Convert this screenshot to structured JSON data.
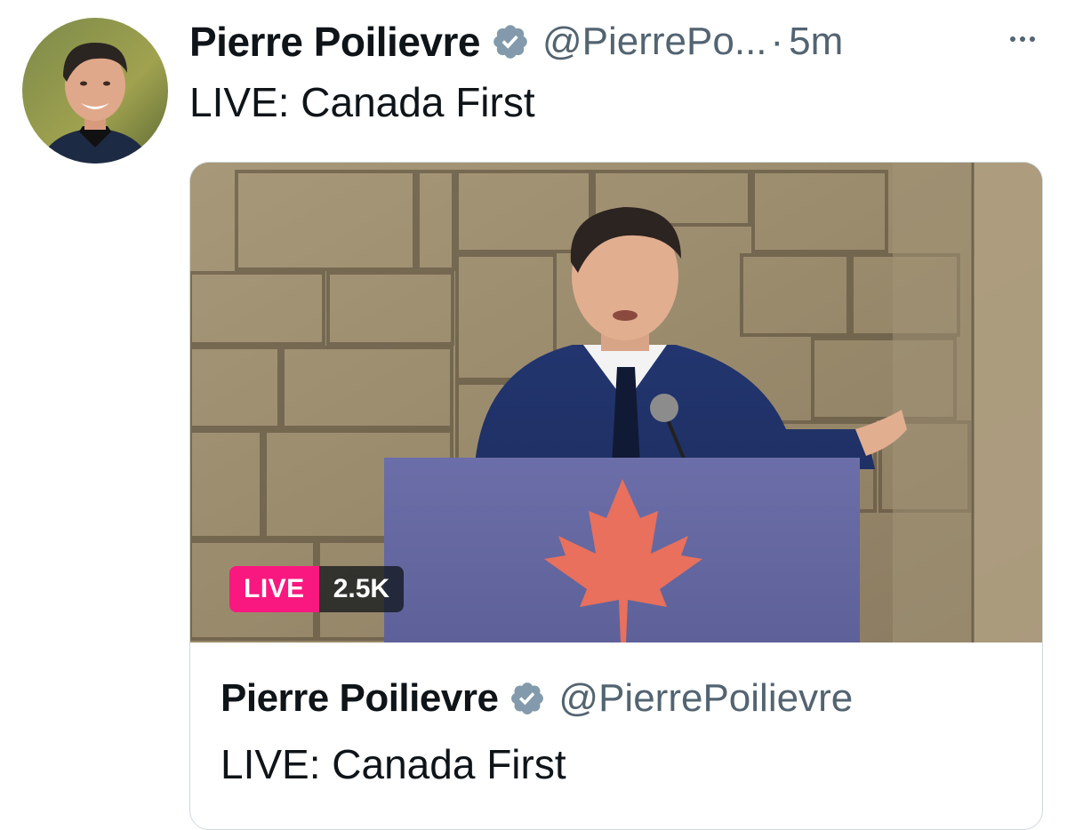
{
  "tweet": {
    "author": {
      "display_name": "Pierre Poilievre",
      "handle": "@PierrePo...",
      "verified": true,
      "avatar_icon": "profile-photo"
    },
    "separator": "·",
    "timestamp": "5m",
    "more_icon": "more-horizontal-icon",
    "text": "LIVE: Canada First"
  },
  "live_card": {
    "badge": {
      "live_label": "LIVE",
      "viewer_count": "2.5K",
      "live_color": "#f91880"
    },
    "author": {
      "display_name": "Pierre Poilievre",
      "handle": "@PierrePoilievre",
      "verified": true
    },
    "title": "LIVE: Canada First"
  },
  "colors": {
    "verified_badge": "#829aab",
    "secondary_text": "#536471",
    "primary_text": "#0f1419",
    "card_border": "#cfd9de"
  }
}
